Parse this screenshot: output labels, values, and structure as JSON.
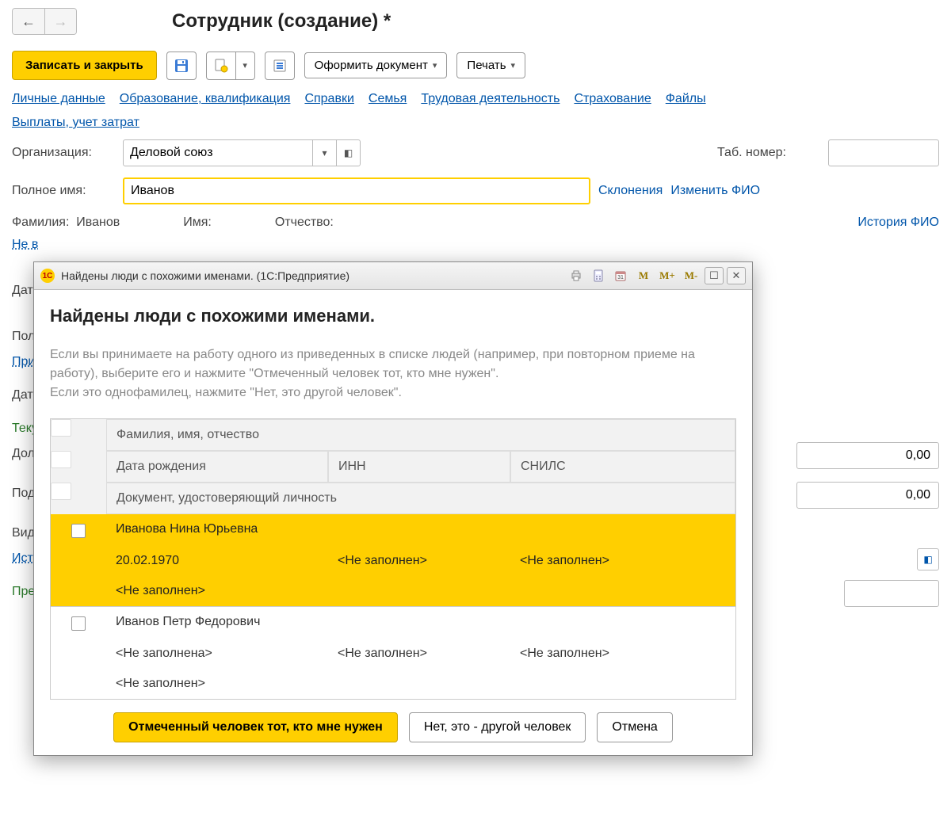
{
  "page": {
    "title": "Сотрудник (создание) *"
  },
  "toolbar": {
    "save_close": "Записать и закрыть",
    "doc": "Оформить документ",
    "print": "Печать"
  },
  "links": {
    "l1": "Личные данные",
    "l2": "Образование, квалификация",
    "l3": "Справки",
    "l4": "Семья",
    "l5": "Трудовая деятельность",
    "l6": "Страхование",
    "l7": "Файлы",
    "l8": "Выплаты, учет затрат"
  },
  "form": {
    "org_label": "Организация:",
    "org_value": "Деловой союз",
    "tabnum_label": "Таб. номер:",
    "fullname_label": "Полное имя:",
    "fullname_value": "Иванов",
    "decl": "Склонения",
    "edit_fio": "Изменить ФИО",
    "surname_label": "Фамилия:",
    "surname_value": "Иванов",
    "name_label": "Имя:",
    "patr_label": "Отчество:",
    "hist_fio": "История ФИО"
  },
  "bg": {
    "l1": "Не в",
    "l2": "Дата",
    "l3": "Пол",
    "l4": "При",
    "l5": "Дата",
    "l6": "Теку",
    "l7": "Дол",
    "l8": "Под",
    "l9": "Вид",
    "l10": "Ист",
    "l11": "Пре",
    "val_zero": "0,00"
  },
  "dialog": {
    "titlebar": "Найдены люди с похожими именами.  (1С:Предприятие)",
    "m1": "M",
    "m2": "M+",
    "m3": "M-",
    "heading": "Найдены люди с похожими именами.",
    "desc1": "Если вы принимаете на работу одного из приведенных в списке людей (например, при повторном приеме на работу), выберите его и нажмите \"Отмеченный человек тот, кто мне нужен\".",
    "desc2": "Если это однофамилец, нажмите \"Нет, это другой человек\".",
    "th_fio": "Фамилия, имя, отчество",
    "th_dob": "Дата рождения",
    "th_inn": "ИНН",
    "th_snils": "СНИЛС",
    "th_doc": "Документ, удостоверяющий личность",
    "rows": [
      {
        "fio": "Иванова Нина Юрьевна",
        "dob": "20.02.1970",
        "inn": "<Не заполнен>",
        "snils": "<Не заполнен>",
        "doc": "<Не заполнен>",
        "selected": true
      },
      {
        "fio": "Иванов Петр Федорович",
        "dob": "<Не заполнена>",
        "inn": "<Не заполнен>",
        "snils": "<Не заполнен>",
        "doc": "<Не заполнен>",
        "selected": false
      }
    ],
    "btn_ok": "Отмеченный человек тот, кто мне нужен",
    "btn_other": "Нет, это - другой человек",
    "btn_cancel": "Отмена"
  }
}
